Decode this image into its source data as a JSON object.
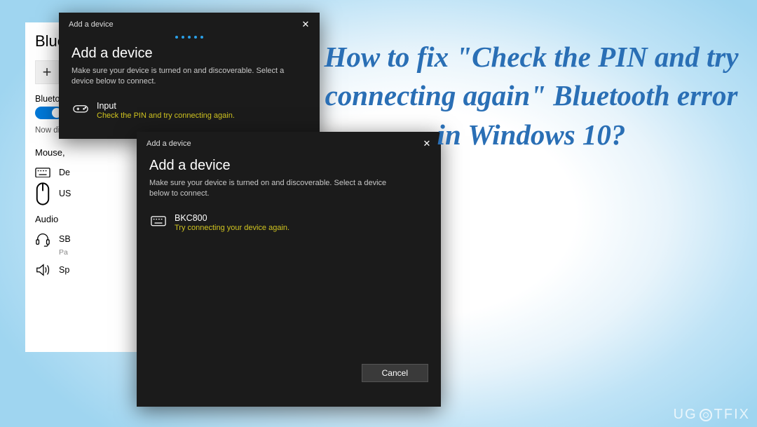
{
  "settings": {
    "title": "Bluetooth",
    "add_label": "Add",
    "bt_label": "Bluetooth",
    "toggle_on": true,
    "status": "Now discoverable",
    "section_mouse": "Mouse,",
    "dev_keyboard": "De",
    "dev_mouse": "US",
    "section_audio": "Audio",
    "dev_headset_name": "SB",
    "dev_headset_sub": "Pa",
    "dev_speaker": "Sp"
  },
  "dialog_a": {
    "titlebar": "Add a device",
    "heading": "Add a device",
    "subtitle": "Make sure your device is turned on and discoverable. Select a device below to connect.",
    "device_name": "Input",
    "device_error": "Check the PIN and try connecting again."
  },
  "dialog_b": {
    "titlebar": "Add a device",
    "heading": "Add a device",
    "subtitle": "Make sure your device is turned on and discoverable. Select a device below to connect.",
    "device_name": "BKC800",
    "device_error": "Try connecting your device again.",
    "cancel": "Cancel"
  },
  "overlay": "How to fix \"Check the PIN and try connecting again\" Bluetooth error in Windows 10?",
  "watermark_a": "UG",
  "watermark_b": "TFIX"
}
